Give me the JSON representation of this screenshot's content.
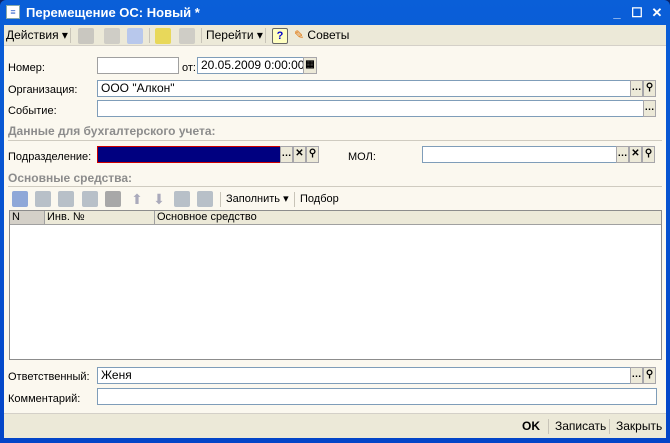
{
  "window": {
    "title": "Перемещение ОС: Новый *"
  },
  "toolbar": {
    "actions": "Действия",
    "goto": "Перейти",
    "tips": "Советы"
  },
  "form": {
    "number_label": "Номер:",
    "number_value": "",
    "date_label": "от:",
    "date_value": "20.05.2009  0:00:00",
    "org_label": "Организация:",
    "org_value": "ООО \"Алкон\"",
    "event_label": "Событие:",
    "event_value": "",
    "section_accounting": "Данные для бухгалтерского учета:",
    "dept_label": "Подразделение:",
    "dept_value": "",
    "mol_label": "МОЛ:",
    "mol_value": "",
    "section_assets": "Основные средства:",
    "responsible_label": "Ответственный:",
    "responsible_value": "Женя",
    "comment_label": "Комментарий:",
    "comment_value": ""
  },
  "table": {
    "fill": "Заполнить",
    "select": "Подбор",
    "columns": [
      "N",
      "Инв. №",
      "Основное средство"
    ],
    "rows": []
  },
  "buttons": {
    "ok": "OK",
    "save": "Записать",
    "close": "Закрыть"
  }
}
